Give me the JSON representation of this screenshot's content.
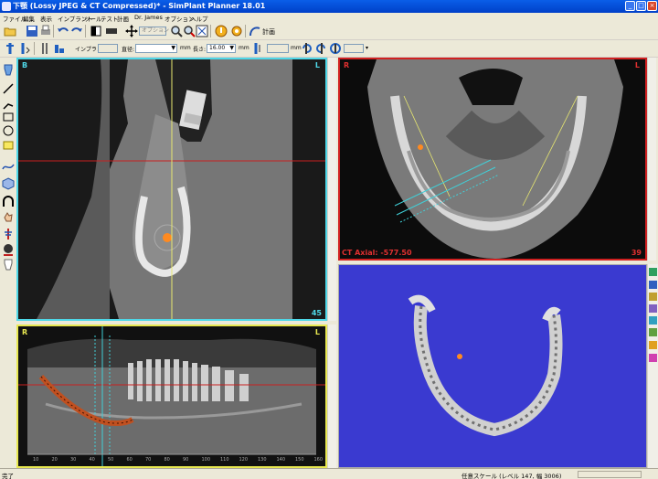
{
  "window": {
    "title": "下顎 (Lossy JPEG & CT Compressed)* - SimPlant Planner  18.01",
    "minimize": "_",
    "maximize": "□",
    "close": "×"
  },
  "menu": [
    "ファイル",
    "編集",
    "表示",
    "インプラント",
    "ツール",
    "テスト",
    "計画",
    "Dr. James",
    "オプション",
    "ヘルプ"
  ],
  "toolbar1": {
    "options_label": "オプション",
    "plan_label": "計画"
  },
  "toolbar2": {
    "implant_label": "インプラント",
    "diameter_label": "直径:",
    "diameter_unit": "mm",
    "length_label": "長さ:",
    "length_value": "16.00",
    "length_unit": "mm",
    "field_unit": "mm"
  },
  "views": {
    "cross_section": {
      "left_marker": "B",
      "right_marker": "L",
      "slice_number": "45"
    },
    "axial": {
      "left_marker": "R",
      "right_marker": "L",
      "label": "CT Axial: -577.50",
      "slice_number": "39"
    },
    "panoramic": {
      "left_marker": "R",
      "right_marker": "L",
      "ruler_ticks": [
        "10",
        "20",
        "30",
        "40",
        "50",
        "60",
        "70",
        "80",
        "90",
        "100",
        "110",
        "120",
        "130",
        "140",
        "150",
        "160"
      ]
    }
  },
  "status": {
    "left": "完了",
    "gray_scale": "任意スケール (レベル 147, 幅 3006)"
  },
  "colors": {
    "cross_border": "#4fd8e8",
    "axial_border": "#d02020",
    "pano_border": "#e8e850",
    "view3d_background": "#3a3ad0",
    "titlebar": "#0a5ee8"
  },
  "icons": {
    "left_toolbar": [
      "tooth-icon",
      "line-icon",
      "polyline-icon",
      "rectangle-icon",
      "circle-icon",
      "note-icon",
      "curve-icon",
      "cube-icon",
      "arch-icon",
      "hand-icon",
      "implant-icon",
      "face-icon",
      "tooth-outline-icon"
    ]
  }
}
